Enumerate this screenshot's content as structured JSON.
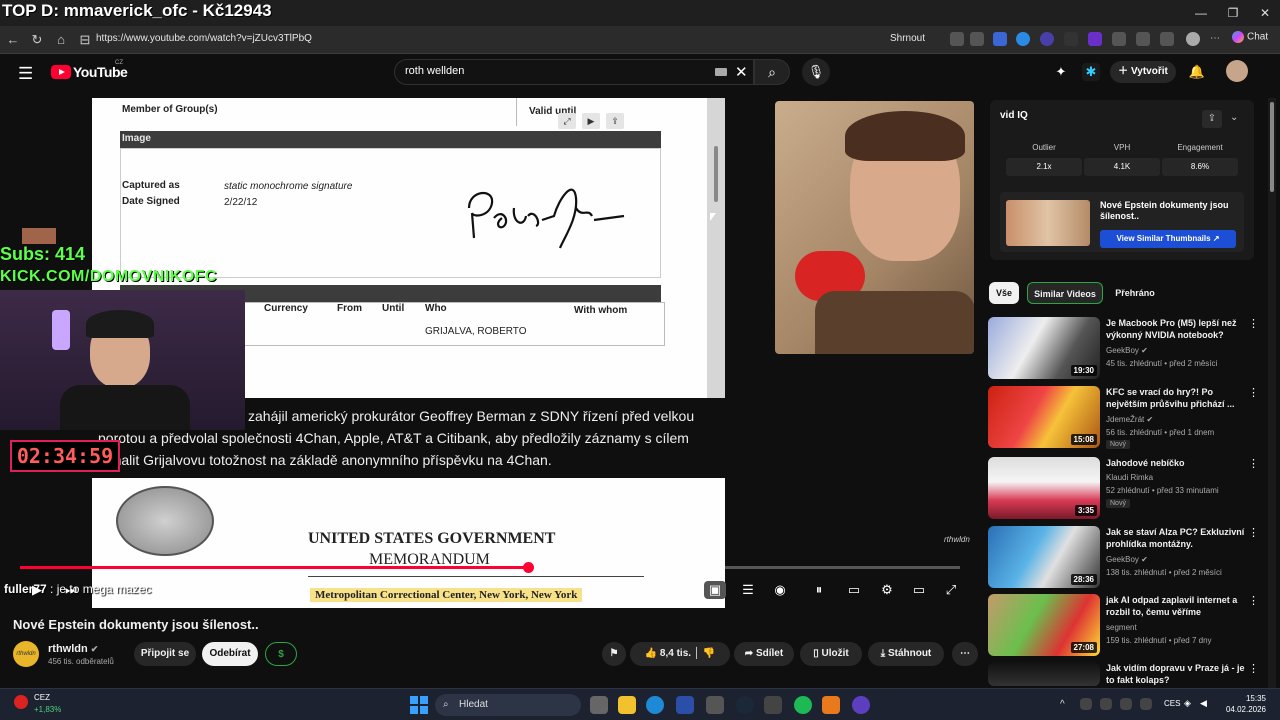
{
  "browser": {
    "stream_overlay_title": "TOP D: mmaverick_ofc - Kč12943",
    "url": "https://www.youtube.com/watch?v=jZUcv3TlPbQ",
    "shrnout_label": "Shrnout",
    "chat_label": "Chat"
  },
  "youtube_header": {
    "logo_text": "YouTube",
    "country": "CZ",
    "search_value": "roth wellden",
    "create_label": "Vytvořit"
  },
  "video": {
    "document1": {
      "member_of_groups": "Member of Group(s)",
      "valid_until": "Valid until",
      "image_heading": "Image",
      "captured_as_label": "Captured as",
      "captured_as_value": "static monochrome signature",
      "date_signed_label": "Date Signed",
      "date_signed_value": "2/22/12",
      "table_headers": [
        "Currency",
        "From",
        "Until",
        "Who",
        "With whom"
      ],
      "table_value": "GRIJALVA, ROBERTO"
    },
    "subtitle_lines": [
      "zahájil americký prokurátor Geoffrey Berman z SDNY řízení před velkou",
      "porotou a předvolal společnosti 4Chan, Apple, AT&T a Citibank, aby předložily záznamy s cílem",
      "odhalit Grijalvovu totožnost na základě anonymního příspěvku na 4Chan."
    ],
    "document2": {
      "line1": "UNITED STATES GOVERNMENT",
      "line2": "MEMORANDUM",
      "line3": "Metropolitan Correctional Center, New York, New York"
    },
    "channel_watermark": "rthwldn",
    "overlay": {
      "subs": "Subs: 414",
      "kick": "KICK.COM/DOMOVNIKOFC",
      "timer": "02:34:59",
      "chat_user": "fuller77",
      "chat_message": ": je to mega mazec"
    },
    "progress": 0.54
  },
  "below_video": {
    "title": "Nové Epstein dokumenty jsou šílenost..",
    "channel_name": "rthwldn",
    "channel_subs": "456 tis. odběratelů",
    "join_label": "Připojit se",
    "subscribe_label": "Odebírat",
    "likes": "8,4 tis.",
    "share_label": "Sdílet",
    "save_label": "Uložit",
    "download_label": "Stáhnout"
  },
  "vidiq": {
    "logo": "vid IQ",
    "stats": [
      {
        "label": "Outlier",
        "value": "2.1x"
      },
      {
        "label": "VPH",
        "value": "4.1K"
      },
      {
        "label": "Engagement",
        "value": "8.6%"
      }
    ],
    "similar_title": "Nové Epstein dokumenty jsou šílenost..",
    "similar_button": "View Similar Thumbnails"
  },
  "chips": [
    "Vše",
    "Similar Videos",
    "Přehráno"
  ],
  "recommendations": [
    {
      "title": "Je Macbook Pro (M5) lepší než výkonný NVIDIA notebook?",
      "channel": "GeekBoy",
      "meta": "45 tis. zhlédnutí • před 2 měsíci",
      "duration": "19:30",
      "badge": ""
    },
    {
      "title": "KFC se vrací do hry?! Po největším průšvihu přichází ...",
      "channel": "JdemeŽrát",
      "meta": "56 tis. zhlédnutí • před 1 dnem",
      "duration": "15:08",
      "badge": "Nový"
    },
    {
      "title": "Jahodové nebíčko",
      "channel": "Klaudi Rimka",
      "meta": "52 zhlédnutí • před 33 minutami",
      "duration": "3:35",
      "badge": "Nový"
    },
    {
      "title": "Jak se staví Alza PC? Exkluzivní prohlídka montážny.",
      "channel": "GeekBoy",
      "meta": "138 tis. zhlédnutí • před 2 měsíci",
      "duration": "28:36",
      "badge": ""
    },
    {
      "title": "jak AI odpad zaplavil internet a rozbil to, čemu věříme",
      "channel": "segment",
      "meta": "159 tis. zhlédnutí • před 7 dny",
      "duration": "27:08",
      "badge": ""
    },
    {
      "title": "Jak vidím dopravu v Praze já - je to fakt kolaps?",
      "channel": "",
      "meta": "",
      "duration": "",
      "badge": ""
    }
  ],
  "taskbar": {
    "stock_name": "CEZ",
    "stock_change": "+1,83%",
    "search_placeholder": "Hledat",
    "language": "CES",
    "time": "15:35",
    "date": "04.02.2026"
  },
  "colors": {
    "accent_red": "#ff0033",
    "kick_green": "#5dff4a",
    "vidiq_blue": "#1d4fd6"
  }
}
